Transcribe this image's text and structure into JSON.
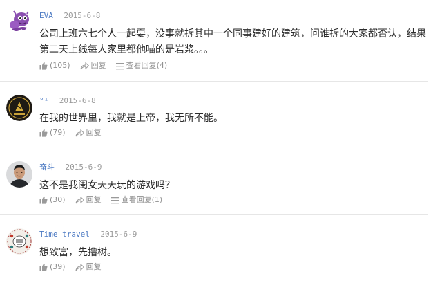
{
  "comments": [
    {
      "username": "EVA",
      "date": "2015-6-8",
      "content": "公司上班六七个人一起耍，没事就拆其中一个同事建好的建筑，问谁拆的大家都否认，结果第二天上线每人家里都他喵的是岩浆。。。",
      "likes": "(105)",
      "reply_label": "回复",
      "view_replies_label": "查看回复(4)",
      "avatar_icon": "purple-monster-icon"
    },
    {
      "username": "°¹",
      "date": "2015-6-8",
      "content": "在我的世界里，我就是上帝，我无所不能。",
      "likes": "(79)",
      "reply_label": "回复",
      "avatar_icon": "gold-emblem-icon"
    },
    {
      "username": "奋斗",
      "date": "2015-6-9",
      "content": "这不是我闺女天天玩的游戏吗？",
      "likes": "(30)",
      "reply_label": "回复",
      "view_replies_label": "查看回复(1)",
      "avatar_icon": "man-portrait-icon"
    },
    {
      "username": "Time travel",
      "date": "2015-6-9",
      "content": "想致富，先撸树。",
      "likes": "(39)",
      "reply_label": "回复",
      "avatar_icon": "floral-badge-icon"
    }
  ],
  "colors": {
    "username": "#4a78c2",
    "muted": "#8f8f8f",
    "text": "#2b2b2b",
    "divider": "#e6e6e6"
  }
}
